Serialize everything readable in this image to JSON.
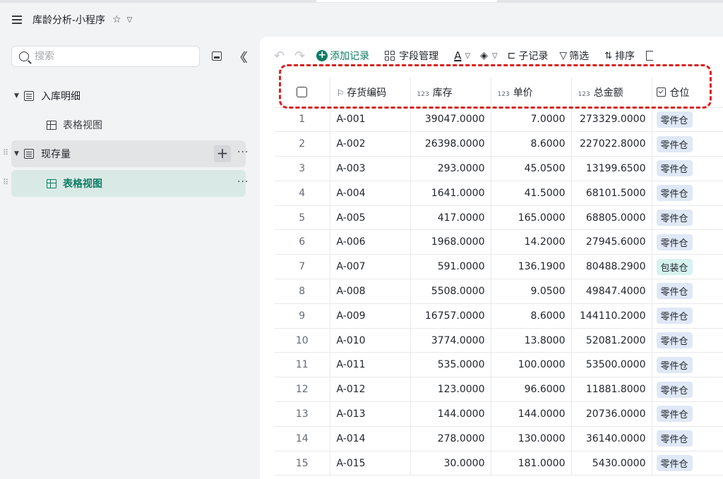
{
  "app": {
    "title": "库龄分析-小程序",
    "star_icon": "☆",
    "title_chevron": "⌄"
  },
  "sidebar": {
    "search_placeholder": "搜索",
    "tree": [
      {
        "label": "入库明细",
        "type": "table",
        "expanded": true
      },
      {
        "label": "表格视图",
        "type": "view",
        "selected": false
      },
      {
        "label": "现存量",
        "type": "table",
        "expanded": true
      },
      {
        "label": "表格视图",
        "type": "view",
        "selected": true
      }
    ]
  },
  "toolbar": {
    "add_record": "添加记录",
    "field_manage": "字段管理",
    "font_letter": "A",
    "sub_record": "子记录",
    "filter": "筛选",
    "sort": "排序"
  },
  "table": {
    "headers": {
      "code": "存货编码",
      "stock": "库存",
      "unit_price": "单价",
      "total": "总金额",
      "location": "仓位",
      "num_prefix": "123"
    },
    "rows": [
      {
        "no": "1",
        "code": "A-001",
        "stock": "39047.0000",
        "price": "7.0000",
        "total": "273329.0000",
        "loc": "零件仓"
      },
      {
        "no": "2",
        "code": "A-002",
        "stock": "26398.0000",
        "price": "8.6000",
        "total": "227022.8000",
        "loc": "零件仓"
      },
      {
        "no": "3",
        "code": "A-003",
        "stock": "293.0000",
        "price": "45.0500",
        "total": "13199.6500",
        "loc": "零件仓"
      },
      {
        "no": "4",
        "code": "A-004",
        "stock": "1641.0000",
        "price": "41.5000",
        "total": "68101.5000",
        "loc": "零件仓"
      },
      {
        "no": "5",
        "code": "A-005",
        "stock": "417.0000",
        "price": "165.0000",
        "total": "68805.0000",
        "loc": "零件仓"
      },
      {
        "no": "6",
        "code": "A-006",
        "stock": "1968.0000",
        "price": "14.2000",
        "total": "27945.6000",
        "loc": "零件仓"
      },
      {
        "no": "7",
        "code": "A-007",
        "stock": "591.0000",
        "price": "136.1900",
        "total": "80488.2900",
        "loc": "包装仓"
      },
      {
        "no": "8",
        "code": "A-008",
        "stock": "5508.0000",
        "price": "9.0500",
        "total": "49847.4000",
        "loc": "零件仓"
      },
      {
        "no": "9",
        "code": "A-009",
        "stock": "16757.0000",
        "price": "8.6000",
        "total": "144110.2000",
        "loc": "零件仓"
      },
      {
        "no": "10",
        "code": "A-010",
        "stock": "3774.0000",
        "price": "13.8000",
        "total": "52081.2000",
        "loc": "零件仓"
      },
      {
        "no": "11",
        "code": "A-011",
        "stock": "535.0000",
        "price": "100.0000",
        "total": "53500.0000",
        "loc": "零件仓"
      },
      {
        "no": "12",
        "code": "A-012",
        "stock": "123.0000",
        "price": "96.6000",
        "total": "11881.8000",
        "loc": "零件仓"
      },
      {
        "no": "13",
        "code": "A-013",
        "stock": "144.0000",
        "price": "144.0000",
        "total": "20736.0000",
        "loc": "零件仓"
      },
      {
        "no": "14",
        "code": "A-014",
        "stock": "278.0000",
        "price": "130.0000",
        "total": "36140.0000",
        "loc": "零件仓"
      },
      {
        "no": "15",
        "code": "A-015",
        "stock": "30.0000",
        "price": "181.0000",
        "total": "5430.0000",
        "loc": "零件仓"
      }
    ]
  },
  "colors": {
    "accent": "#0e7c64",
    "highlight_dashed": "#d8201c",
    "tag_blue": "#dfe8f6",
    "tag_teal": "#d6f3ef"
  }
}
